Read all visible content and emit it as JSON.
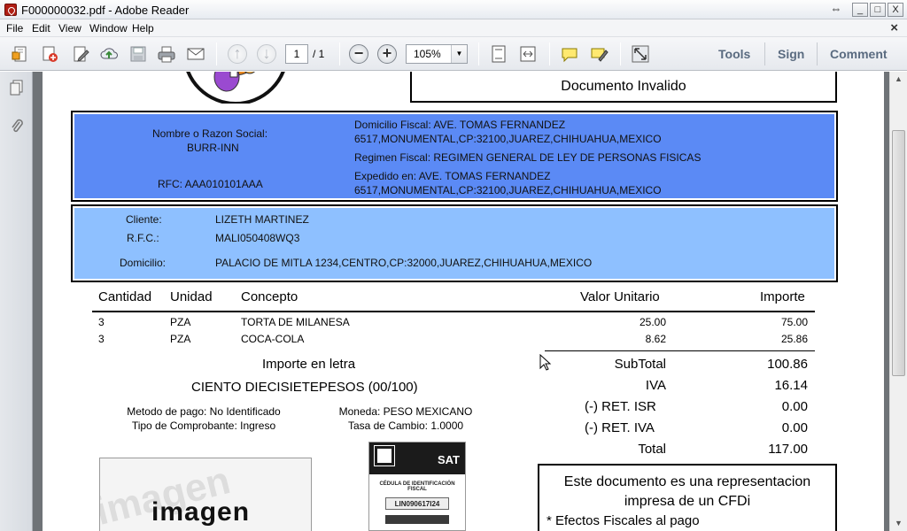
{
  "window": {
    "title": "F000000032.pdf - Adobe Reader",
    "minimize": "_",
    "maximize": "□",
    "close": "X",
    "resize": "⇔"
  },
  "menu": {
    "items": [
      "File",
      "Edit",
      "View",
      "Window",
      "Help"
    ],
    "close": "×"
  },
  "toolbar": {
    "page_current": "1",
    "page_of": "/ 1",
    "zoom": "105%",
    "zoom_dropdown": "▼",
    "zoom_out": "−",
    "zoom_in": "+",
    "right_tools": [
      "Tools",
      "Sign",
      "Comment"
    ]
  },
  "document": {
    "invalid_label": "Documento Invalido",
    "emisor": {
      "nombre_label": "Nombre o Razon Social:",
      "nombre": "BURR-INN",
      "rfc": "RFC: AAA010101AAA",
      "domicilio_l1": "Domicilio Fiscal: AVE. TOMAS FERNANDEZ",
      "domicilio_l2": "6517,MONUMENTAL,CP:32100,JUAREZ,CHIHUAHUA,MEXICO",
      "regimen": "Regimen Fiscal: REGIMEN GENERAL DE LEY DE PERSONAS FISICAS",
      "expedido_l1": "Expedido en: AVE. TOMAS FERNANDEZ",
      "expedido_l2": "6517,MONUMENTAL,CP:32100,JUAREZ,CHIHUAHUA,MEXICO"
    },
    "receptor": {
      "cliente_label": "Cliente:",
      "cliente": "LIZETH MARTINEZ",
      "rfc_label": "R.F.C.:",
      "rfc": "MALI050408WQ3",
      "domicilio_label": "Domicilio:",
      "domicilio": "PALACIO DE MITLA 1234,CENTRO,CP:32000,JUAREZ,CHIHUAHUA,MEXICO"
    },
    "table": {
      "headers": {
        "cantidad": "Cantidad",
        "unidad": "Unidad",
        "concepto": "Concepto",
        "valor": "Valor Unitario",
        "importe": "Importe"
      },
      "rows": [
        {
          "cantidad": "3",
          "unidad": "PZA",
          "concepto": "TORTA DE MILANESA",
          "valor": "25.00",
          "importe": "75.00"
        },
        {
          "cantidad": "3",
          "unidad": "PZA",
          "concepto": "COCA-COLA",
          "valor": "8.62",
          "importe": "25.86"
        }
      ]
    },
    "importe_letra_label": "Importe en letra",
    "importe_letra": "CIENTO DIECISIETEPESOS (00/100)",
    "metodo_pago": "Metodo de pago: No Identificado",
    "tipo_comprobante": "Tipo de Comprobante: Ingreso",
    "moneda": "Moneda: PESO MEXICANO",
    "tipo_cambio": "Tasa de Cambio: 1.0000",
    "totals": [
      {
        "label": "SubTotal",
        "value": "100.86"
      },
      {
        "label": "IVA",
        "value": "16.14"
      },
      {
        "label": "(-)  RET. ISR",
        "value": "0.00"
      },
      {
        "label": "(-)  RET. IVA",
        "value": "0.00"
      },
      {
        "label": "Total",
        "value": "117.00"
      }
    ],
    "representacion_l1": "Este documento es una representacion",
    "representacion_l2": "impresa de un CFDi",
    "efectos": "* Efectos Fiscales al pago",
    "image_placeholder": "imagen",
    "image_watermark": "imagen",
    "sat_card": {
      "brand": "SAT",
      "title": "CÉDULA DE IDENTIFICACIÓN FISCAL",
      "code": "LIN090617I24"
    }
  }
}
